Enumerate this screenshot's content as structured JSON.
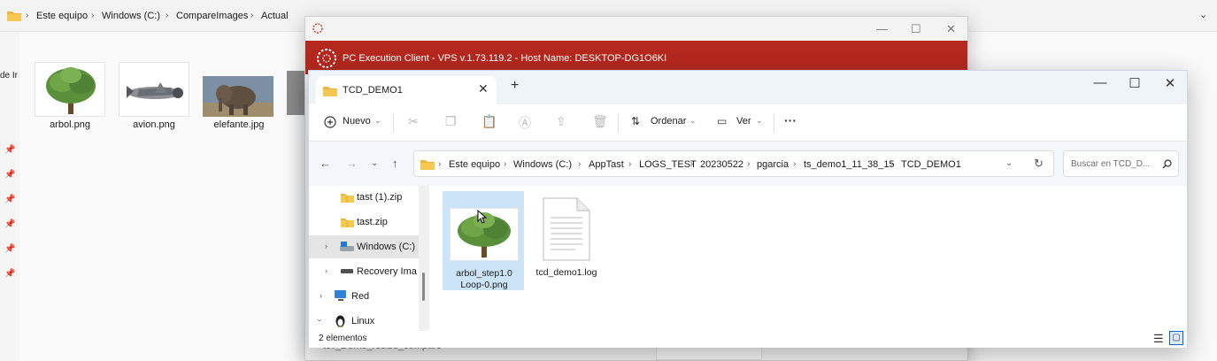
{
  "background_window": {
    "breadcrumb": [
      "Este equipo",
      "Windows (C:)",
      "CompareImages",
      "Actual"
    ],
    "left_cut_text": "de Ir",
    "thumbnails": [
      {
        "label": "arbol.png",
        "icon": "tree-image-icon"
      },
      {
        "label": "avion.png",
        "icon": "airplane-image-icon"
      },
      {
        "label": "elefante.jpg",
        "icon": "elephant-image-icon"
      }
    ]
  },
  "vps_window": {
    "title": "PC Execution Client - VPS v.1.73.119.2 - Host Name: DESKTOP-DG1O6KI",
    "header_color": "#b5281e",
    "bottom_text": "tcv_Demo_resize_compare"
  },
  "explorer": {
    "tab_title": "TCD_DEMO1",
    "toolbar": {
      "new_label": "Nuevo",
      "sort_label": "Ordenar",
      "view_label": "Ver",
      "more_label": "···"
    },
    "path": [
      "Este equipo",
      "Windows (C:)",
      "AppTast",
      "LOGS_TEST",
      "20230522",
      "pgarcia",
      "ts_demo1_11_38_15",
      "TCD_DEMO1"
    ],
    "search_placeholder": "Buscar en TCD_D...",
    "nav_items": [
      {
        "label": "tast (1).zip",
        "icon": "zip-folder-icon"
      },
      {
        "label": "tast.zip",
        "icon": "zip-folder-icon"
      },
      {
        "label": "Windows  (C:)",
        "icon": "drive-icon"
      },
      {
        "label": "Recovery Imag",
        "icon": "drive-icon"
      },
      {
        "label": "Red",
        "icon": "network-icon"
      },
      {
        "label": "Linux",
        "icon": "linux-icon"
      }
    ],
    "files": [
      {
        "name": "arbol_step1.0 Loop-0.png",
        "icon": "tree-image-icon",
        "selected": true
      },
      {
        "name": "tcd_demo1.log",
        "icon": "text-file-icon",
        "selected": false
      }
    ],
    "status_text": "2 elementos",
    "accent_color": "#0067c0"
  }
}
